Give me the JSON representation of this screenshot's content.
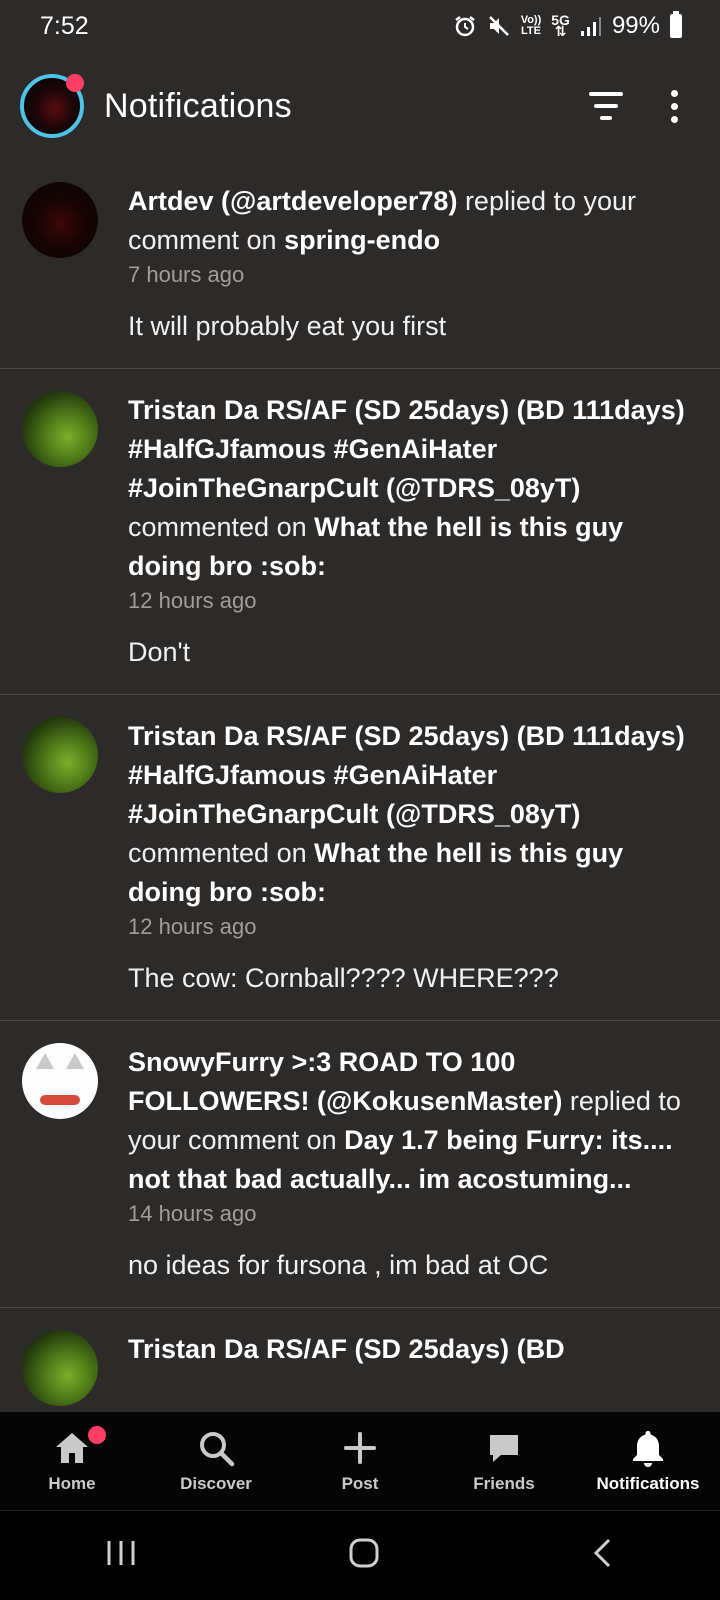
{
  "status_bar": {
    "time": "7:52",
    "lte_label_top": "Vo))",
    "lte_label_bottom": "LTE",
    "network_label": "5G",
    "battery": "99%"
  },
  "header": {
    "title": "Notifications"
  },
  "notifications": [
    {
      "actor": "Artdev (@artdeveloper78)",
      "action": " replied to your comment on ",
      "target": "spring-endo",
      "time": "7 hours ago",
      "comment": "It will probably eat you first"
    },
    {
      "actor": "Tristan Da RS/AF (SD 25days) (BD 111days) #HalfGJfamous #GenAiHater #JoinTheGnarpCult (@TDRS_08yT)",
      "action": " commented on ",
      "target": "What the hell is this guy doing bro :sob:",
      "time": "12 hours ago",
      "comment": "Don't"
    },
    {
      "actor": "Tristan Da RS/AF (SD 25days) (BD 111days) #HalfGJfamous #GenAiHater #JoinTheGnarpCult (@TDRS_08yT)",
      "action": " commented on ",
      "target": "What the hell is this guy doing bro :sob:",
      "time": "12 hours ago",
      "comment": "The cow: Cornball???? WHERE???"
    },
    {
      "actor": "SnowyFurry >:3 ROAD TO 100 FOLLOWERS! (@KokusenMaster)",
      "action": " replied to your comment on ",
      "target": "Day 1.7 being Furry: its.... not that bad actually... im acostuming...",
      "time": "14 hours ago",
      "comment": "no ideas for fursona , im bad at OC"
    },
    {
      "actor": "Tristan Da RS/AF (SD 25days) (BD",
      "action": "",
      "target": "",
      "time": "",
      "comment": ""
    }
  ],
  "bottom_nav": {
    "home": "Home",
    "discover": "Discover",
    "post": "Post",
    "friends": "Friends",
    "notifications": "Notifications"
  },
  "colors": {
    "background": "#2d2b2a",
    "accent_badge": "#ff3e63",
    "avatar_ring": "#4dc3e6"
  },
  "icons": {
    "status": [
      "alarm-icon",
      "mute-icon",
      "volte-icon",
      "5g-icon",
      "signal-icon",
      "battery-icon"
    ],
    "header": [
      "filter-icon",
      "more-options-icon"
    ],
    "nav": [
      "home-icon",
      "search-icon",
      "plus-icon",
      "chat-icon",
      "bell-icon"
    ],
    "system": [
      "recent-apps-icon",
      "home-system-icon",
      "back-icon"
    ]
  }
}
